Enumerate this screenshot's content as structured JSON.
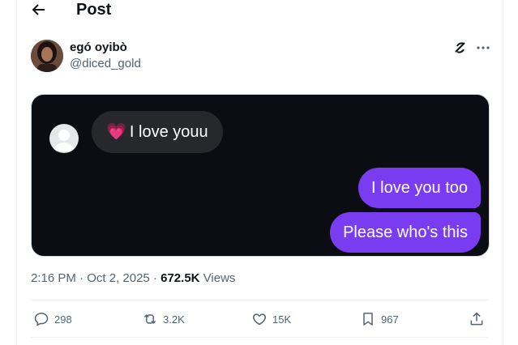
{
  "header": {
    "title": "Post",
    "back_icon": "arrow-left-icon"
  },
  "author": {
    "name": "egó oyibò",
    "handle": "@diced_gold"
  },
  "tweet_icons": {
    "grok": "grok-icon",
    "more": "more-icon"
  },
  "chat": {
    "incoming": {
      "emoji": "💗",
      "text": "I love youu"
    },
    "outgoing": [
      "I love you too",
      "Please who's this"
    ]
  },
  "meta": {
    "time": "2:16 PM",
    "separator": " · ",
    "date": "Oct 2, 2025",
    "views_count": "672.5K",
    "views_label": "Views"
  },
  "actions": {
    "replies": "298",
    "reposts": "3.2K",
    "likes": "15K",
    "bookmarks": "967"
  },
  "colors": {
    "bubble_out": "#7a3cf0",
    "bubble_in": "#26282c",
    "media_bg": "#0b0d12"
  }
}
